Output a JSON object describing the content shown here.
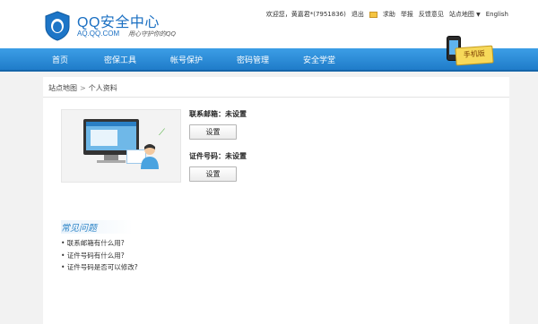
{
  "header": {
    "title": "QQ安全中心",
    "domain": "AQ.QQ.COM",
    "slogan": "用心守护你的QQ"
  },
  "topbar": {
    "greeting": "欢迎您，黄嘉君*(7951836)",
    "logout": "退出",
    "help": "求助",
    "report": "举报",
    "feedback": "反馈意见",
    "sitemap": "站点地图",
    "language": "English"
  },
  "nav": {
    "items": [
      "首页",
      "密保工具",
      "帐号保护",
      "密码管理",
      "安全学堂"
    ],
    "promo": "手机版"
  },
  "breadcrumb": {
    "root": "站点地图",
    "separator": ">",
    "current": "个人资料"
  },
  "profile": {
    "email_label": "联系邮箱：未设置",
    "email_button": "设置",
    "id_label": "证件号码：未设置",
    "id_button": "设置"
  },
  "faq": {
    "title": "常见问题",
    "items": [
      "• 联系邮箱有什么用?",
      "• 证件号码有什么用?",
      "• 证件号码是否可以修改?"
    ]
  },
  "colors": {
    "brand_blue": "#1a6fc2",
    "nav_blue": "#2a8ad8",
    "faq_blue": "#2f86c8"
  }
}
